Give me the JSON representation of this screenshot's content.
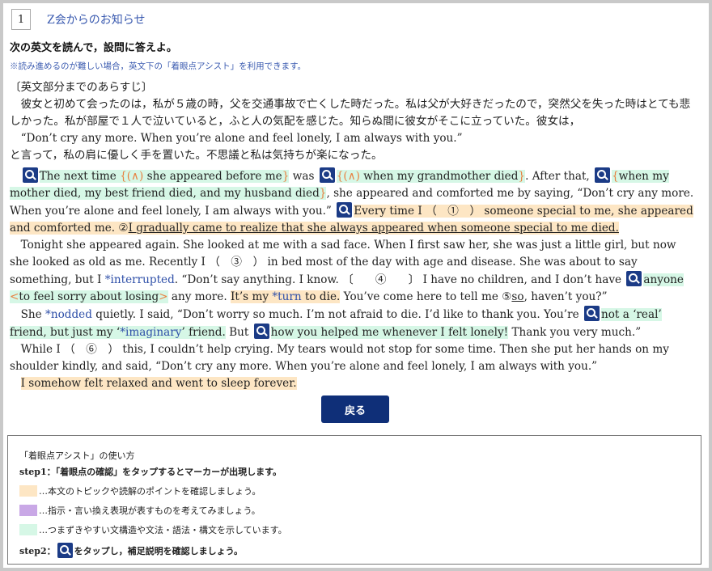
{
  "header": {
    "number": "1",
    "title": "Z会からのお知らせ"
  },
  "instruction": "次の英文を読んで，設問に答えよ。",
  "note": "※読み進めるのが難しい場合，英文下の「着眼点アシスト」を利用できます。",
  "synopsis": {
    "heading": "〔英文部分までのあらすじ〕",
    "line1": "彼女と初めて会ったのは，私が５歳の時，父を交通事故で亡くした時だった。私は父が大好きだったので，突然父を失った時はとても悲しかった。私が部屋で１人で泣いていると，ふと人の気配を感じた。知らぬ間に彼女がそこに立っていた。彼女は，",
    "quote": "“Don’t cry any more. When you’re alone and feel lonely, I am always with you.”",
    "line2": "と言って，私の肩に優しく手を置いた。不思議と私は気持ちが楽になった。"
  },
  "passage": {
    "p1": {
      "t1": "The next time ",
      "t2": "{(∧)",
      "t3": " she appeared before me",
      "t4": "}",
      "t5": " was ",
      "t6": "{(∧)",
      "t7": " when my grandmother died",
      "t8": "}",
      "t9": ". After that, ",
      "t10": "{",
      "t11": "when my mother died, my best friend died, and my husband died",
      "t12": "}",
      "t13": ", she appeared and comforted me by saying, “Don’t cry any more. When you’re alone and feel lonely, I am always with you.” ",
      "t14": "Every time I （　①　） someone special to me, she appeared and comforted me. ②",
      "t15": "I gradually came to realize that she always appeared when someone special to me died."
    },
    "p2": {
      "t1": "Tonight she appeared again. She looked at me with a sad face. When I first saw her, she was just a little girl, but now she looked as old as me. Recently I （　③　） in bed most of the day with age and disease. She was about to say something, but I ",
      "t2": "*interrupted",
      "t3": ". “Don’t say anything. I know. 〔　　④　　〕 I have no children, and I don’t have ",
      "t4": "anyone ",
      "t5": "<",
      "t6": "to feel sorry about losing",
      "t7": ">",
      "t8": " any more. ",
      "t9": "It’s my ",
      "t10": "*turn",
      "t11": " to die.",
      "t12": " You’ve come here to tell me ⑤",
      "t13": "so",
      "t14": ", haven’t you?”"
    },
    "p3": {
      "t1": "She ",
      "t2": "*nodded",
      "t3": " quietly. I said, “Don’t worry so much. I’m not afraid to die. I’d like to thank you. You’re ",
      "t4": "not a ‘real’ friend, but just my ‘",
      "t5": "*imaginary",
      "t6": "’ friend.",
      "t7": " But ",
      "t8": "how you helped me whenever I felt lonely!",
      "t9": " Thank you very much.”"
    },
    "p4": {
      "t1": "While I （　⑥　） this, I couldn’t help crying. My tears would not stop for some time. Then she put her hands on my shoulder kindly, and said, “Don’t cry any more. When you’re alone and feel lonely, I am always with you.”"
    },
    "p5": {
      "t1": "I somehow felt relaxed and went to sleep forever."
    }
  },
  "back_button": "戻る",
  "assist": {
    "title": "「着眼点アシスト」の使い方",
    "step1": "step1：「着眼点の確認」をタップするとマーカーが出現します。",
    "legend_orange": "…本文のトピックや読解のポイントを確認しましょう。",
    "legend_purple": "…指示・言い換え表現が表すものを考えてみましょう。",
    "legend_green": "…つまずきやすい文構造や文法・語法・構文を示しています。",
    "step2_prefix": "step2：",
    "step2_suffix": "をタップし，補足説明を確認しましょう。"
  },
  "colors": {
    "orange": "#fde6c4",
    "purple": "#c9a8e6",
    "green": "#d6f7e6",
    "accent": "#1b3b86"
  }
}
